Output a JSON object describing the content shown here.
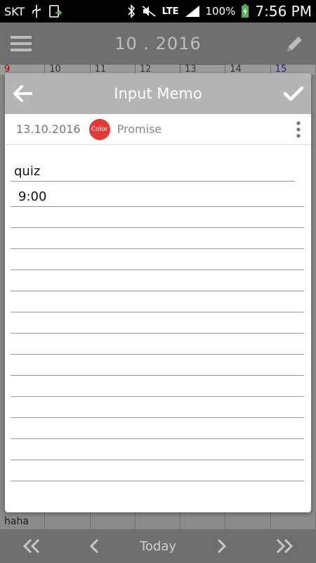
{
  "status_bar": {
    "carrier": "SKT",
    "network": "LTE",
    "battery": "100%",
    "time": "7:56 PM"
  },
  "background": {
    "month_title": "10 . 2016",
    "day_headers": [
      "9",
      "10",
      "11",
      "12",
      "13",
      "14",
      "15"
    ],
    "bottom_row": [
      "haha",
      "",
      "",
      "",
      "",
      "",
      ""
    ],
    "today_label": "Today"
  },
  "dialog": {
    "title": "Input Memo",
    "date": "13.10.2016",
    "color_label": "Color",
    "category": "Promise",
    "memo_title": "quiz",
    "memo_lines": [
      "9:00",
      "",
      "",
      "",
      "",
      "",
      "",
      "",
      "",
      "",
      "",
      "",
      "",
      ""
    ]
  },
  "colors": {
    "accent_red": "#e53935",
    "dialog_header": "#b4b4b4"
  }
}
